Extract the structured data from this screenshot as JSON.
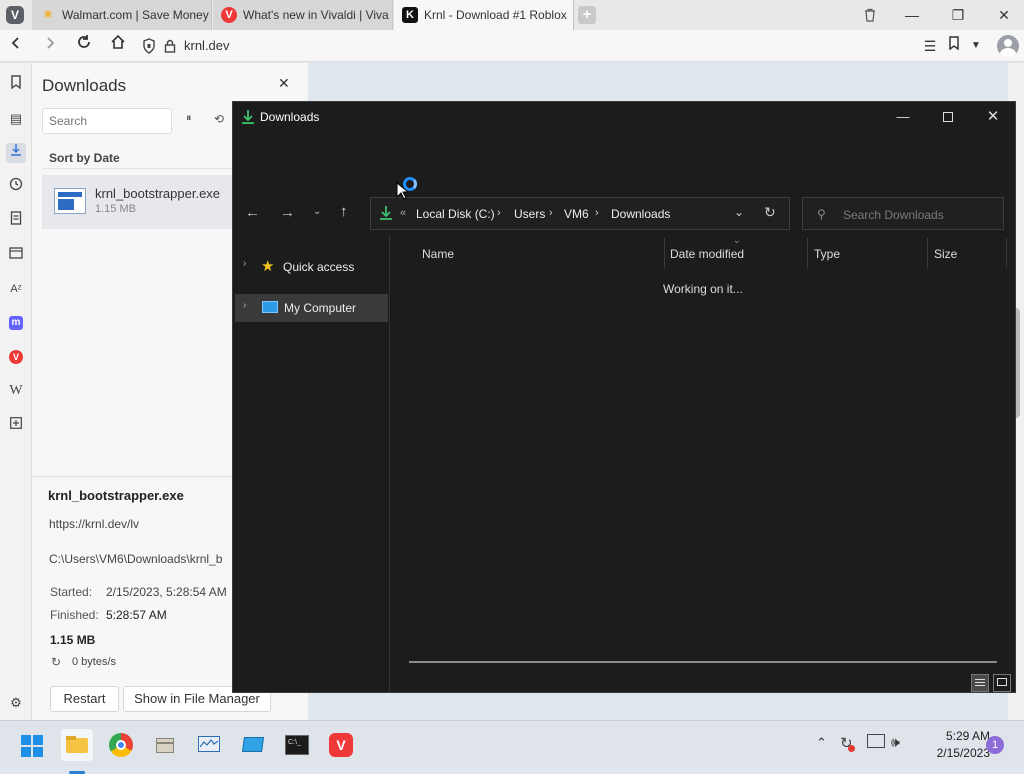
{
  "browser": {
    "logo": "V",
    "tabs": [
      {
        "label": "Walmart.com | Save Money",
        "icon": "walmart-spark-icon",
        "icon_char": "✳",
        "icon_color": "#f2b31a",
        "active": false
      },
      {
        "label": "What's new in Vivaldi | Viva",
        "icon": "vivaldi-icon",
        "icon_char": "V",
        "icon_color": "#ef3939",
        "active": false
      },
      {
        "label": "Krnl - Download #1 Roblox",
        "icon": "krnl-icon",
        "icon_char": "K",
        "icon_color": "#111111",
        "active": true
      }
    ],
    "new_tab": "+",
    "url": "krnl.dev"
  },
  "downloads_panel": {
    "title": "Downloads",
    "search_placeholder": "Search",
    "sort_label": "Sort by Date",
    "item": {
      "name": "krnl_bootstrapper.exe",
      "size": "1.15 MB"
    },
    "details": {
      "filename": "krnl_bootstrapper.exe",
      "url": "https://krnl.dev/lv",
      "path": "C:\\Users\\VM6\\Downloads\\krnl_b",
      "started_label": "Started:",
      "started_value": "2/15/2023, 5:28:54 AM",
      "finished_label": "Finished:",
      "finished_value": "5:28:57 AM",
      "size": "1.15 MB",
      "speed": "0 bytes/s"
    },
    "restart_label": "Restart",
    "show_label": "Show in File Manager"
  },
  "explorer": {
    "title": "Downloads",
    "breadcrumb": {
      "overflow": "«",
      "parts": [
        "Local Disk (C:)",
        "Users",
        "VM6",
        "Downloads"
      ]
    },
    "search_placeholder": "Search Downloads",
    "nav": [
      {
        "label": "Quick access",
        "icon": "star-icon"
      },
      {
        "label": "My Computer",
        "icon": "computer-icon"
      }
    ],
    "columns": [
      "Name",
      "Date modified",
      "Type",
      "Size"
    ],
    "status": "Working on it..."
  },
  "taskbar": {
    "time": "5:29 AM",
    "date": "2/15/2023",
    "notification_count": "1"
  }
}
